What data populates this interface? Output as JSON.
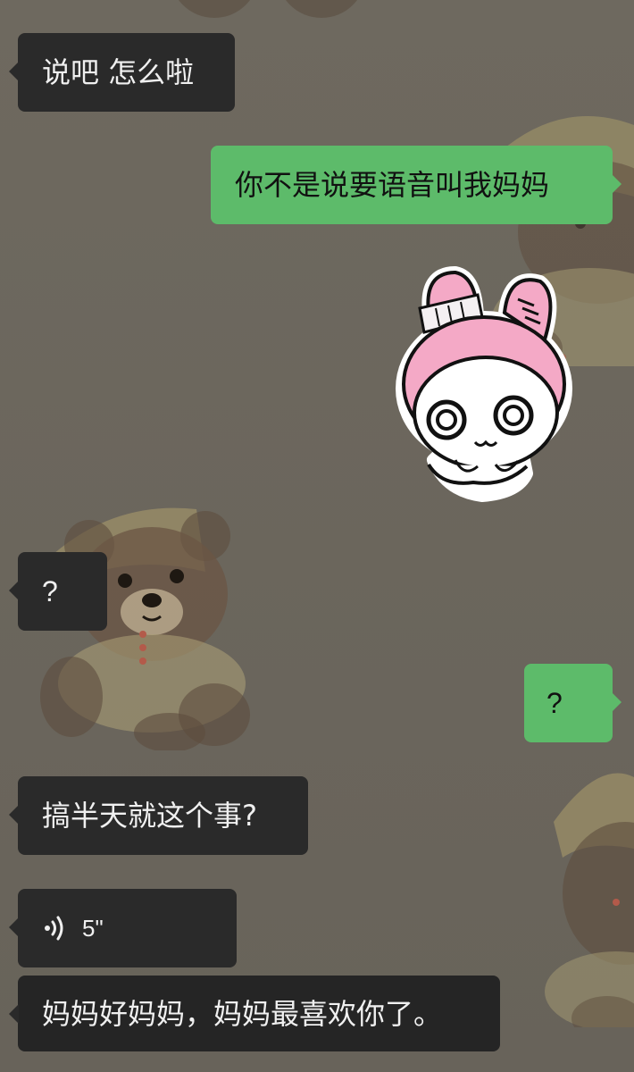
{
  "messages": [
    {
      "direction": "incoming",
      "type": "text",
      "text": "说吧 怎么啦"
    },
    {
      "direction": "outgoing",
      "type": "text",
      "text": "你不是说要语音叫我妈妈"
    },
    {
      "direction": "outgoing",
      "type": "sticker",
      "sticker_name": "bunny-hood-cute-sticker"
    },
    {
      "direction": "incoming",
      "type": "text",
      "text": "?"
    },
    {
      "direction": "outgoing",
      "type": "text",
      "text": "?"
    },
    {
      "direction": "incoming",
      "type": "text",
      "text": "搞半天就这个事?"
    },
    {
      "direction": "incoming",
      "type": "voice",
      "duration": "5\"",
      "icon": "voice-wave-icon"
    },
    {
      "direction": "incoming",
      "type": "transcription",
      "text": "妈妈好妈妈，妈妈最喜欢你了。"
    }
  ],
  "wallpaper": {
    "motif": "teddy-bear-with-nightcap"
  },
  "colors": {
    "background": "#6b665c",
    "incoming_bubble": "#2a2a2a",
    "outgoing_bubble": "#5dbb6a",
    "incoming_text": "#f0f0f0",
    "outgoing_text": "#111111"
  }
}
